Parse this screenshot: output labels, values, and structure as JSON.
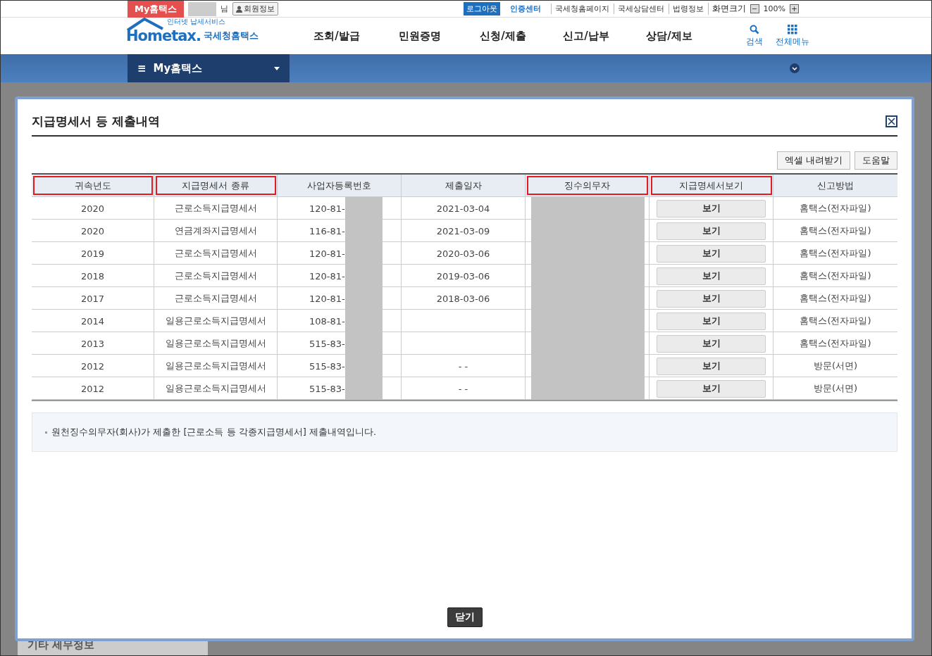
{
  "top_bar": {
    "my_hometax": "My홈택스",
    "user_suffix": "님",
    "member_info": "회원정보",
    "logout": "로그아웃",
    "cert_center": "인증센터",
    "links": [
      "국세청홈페이지",
      "국세상담센터",
      "법령정보"
    ],
    "screen_size_label": "화면크기",
    "zoom_minus": "−",
    "zoom_value": "100%",
    "zoom_plus": "+"
  },
  "header": {
    "logo_tagline": "인터넷 납세서비스",
    "logo_main": "Hometax.",
    "logo_sub": "국세청홈택스",
    "nav": [
      "조회/발급",
      "민원증명",
      "신청/제출",
      "신고/납부",
      "상담/제보"
    ],
    "search": "검색",
    "all_menu": "전체메뉴"
  },
  "breadcrumb": {
    "menu_icon": "≡",
    "title": "My홈택스"
  },
  "sidebar_peek": "기타 세무정보",
  "modal": {
    "title": "지급명세서 등 제출내역",
    "buttons": [
      "엑셀 내려받기",
      "도움말"
    ],
    "columns": [
      {
        "label": "귀속년도",
        "highlighted": true
      },
      {
        "label": "지급명세서 종류",
        "highlighted": true
      },
      {
        "label": "사업자등록번호",
        "highlighted": false
      },
      {
        "label": "제출일자",
        "highlighted": false
      },
      {
        "label": "징수의무자",
        "highlighted": true
      },
      {
        "label": "지급명세서보기",
        "highlighted": true
      },
      {
        "label": "신고방법",
        "highlighted": false
      }
    ],
    "rows": [
      {
        "year": "2020",
        "type": "근로소득지급명세서",
        "biz_no": "120-81-",
        "date": "2021-03-04",
        "redacted": true,
        "view": "보기",
        "method": "홈택스(전자파일)"
      },
      {
        "year": "2020",
        "type": "연금계좌지급명세서",
        "biz_no": "116-81-",
        "date": "2021-03-09",
        "redacted": true,
        "view": "보기",
        "method": "홈택스(전자파일)"
      },
      {
        "year": "2019",
        "type": "근로소득지급명세서",
        "biz_no": "120-81-",
        "date": "2020-03-06",
        "redacted": true,
        "view": "보기",
        "method": "홈택스(전자파일)"
      },
      {
        "year": "2018",
        "type": "근로소득지급명세서",
        "biz_no": "120-81-",
        "date": "2019-03-06",
        "redacted": true,
        "view": "보기",
        "method": "홈택스(전자파일)"
      },
      {
        "year": "2017",
        "type": "근로소득지급명세서",
        "biz_no": "120-81-",
        "date": "2018-03-06",
        "redacted": true,
        "view": "보기",
        "method": "홈택스(전자파일)"
      },
      {
        "year": "2014",
        "type": "일용근로소득지급명세서",
        "biz_no": "108-81-",
        "redacted": true,
        "view": "보기",
        "method": "홈택스(전자파일)"
      },
      {
        "year": "2013",
        "type": "일용근로소득지급명세서",
        "biz_no": "515-83-",
        "redacted": true,
        "view": "보기",
        "method": "홈택스(전자파일)"
      },
      {
        "year": "2012",
        "type": "일용근로소득지급명세서",
        "biz_no": "515-83-",
        "date": "- -",
        "redacted": true,
        "view": "보기",
        "method": "방문(서면)"
      },
      {
        "year": "2012",
        "type": "일용근로소득지급명세서",
        "biz_no": "515-83-",
        "date": "- -",
        "redacted": true,
        "view": "보기",
        "method": "방문(서면)"
      }
    ],
    "note": "원천징수의무자(회사)가 제출한 [근로소득 등 각종지급명세서] 제출내역입니다.",
    "close": "닫기"
  }
}
